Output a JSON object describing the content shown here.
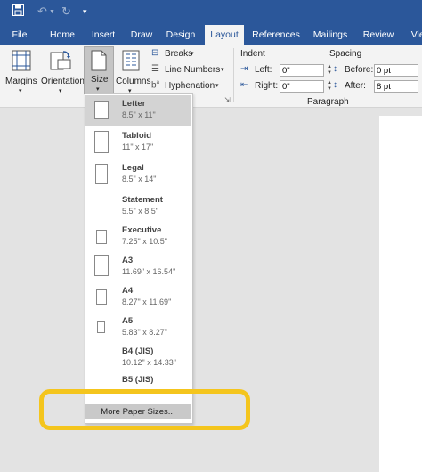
{
  "quick_access": {
    "save_icon": "save-icon",
    "undo_icon": "undo-icon",
    "redo_icon": "redo-icon",
    "customize_icon": "customize-icon"
  },
  "tabs": [
    {
      "label": "File"
    },
    {
      "label": "Home"
    },
    {
      "label": "Insert"
    },
    {
      "label": "Draw"
    },
    {
      "label": "Design"
    },
    {
      "label": "Layout",
      "active": true
    },
    {
      "label": "References"
    },
    {
      "label": "Mailings"
    },
    {
      "label": "Review"
    },
    {
      "label": "View"
    }
  ],
  "ribbon": {
    "margins_label": "Margins",
    "orientation_label": "Orientation",
    "size_label": "Size",
    "columns_label": "Columns",
    "breaks_label": "Breaks",
    "line_numbers_label": "Line Numbers",
    "hyphenation_label": "Hyphenation",
    "indent_header": "Indent",
    "spacing_header": "Spacing",
    "left_label": "Left:",
    "left_value": "0\"",
    "right_label": "Right:",
    "right_value": "0\"",
    "before_label": "Before:",
    "before_value": "0 pt",
    "after_label": "After:",
    "after_value": "8 pt",
    "paragraph_group": "Paragraph"
  },
  "size_menu": {
    "items": [
      {
        "name": "Letter",
        "dims": "8.5\" x 11\""
      },
      {
        "name": "Tabloid",
        "dims": "11\" x 17\""
      },
      {
        "name": "Legal",
        "dims": "8.5\" x 14\""
      },
      {
        "name": "Statement",
        "dims": "5.5\" x 8.5\""
      },
      {
        "name": "Executive",
        "dims": "7.25\" x 10.5\""
      },
      {
        "name": "A3",
        "dims": "11.69\" x 16.54\""
      },
      {
        "name": "A4",
        "dims": "8.27\" x 11.69\""
      },
      {
        "name": "A5",
        "dims": "5.83\" x 8.27\""
      },
      {
        "name": "B4 (JIS)",
        "dims": "10.12\" x 14.33\""
      },
      {
        "name": "B5 (JIS)",
        "dims": ""
      }
    ],
    "more_label": "More Paper Sizes..."
  },
  "colors": {
    "title_bar": "#2b579a",
    "ribbon": "#f3f3f3",
    "highlight": "#f4c51d"
  }
}
